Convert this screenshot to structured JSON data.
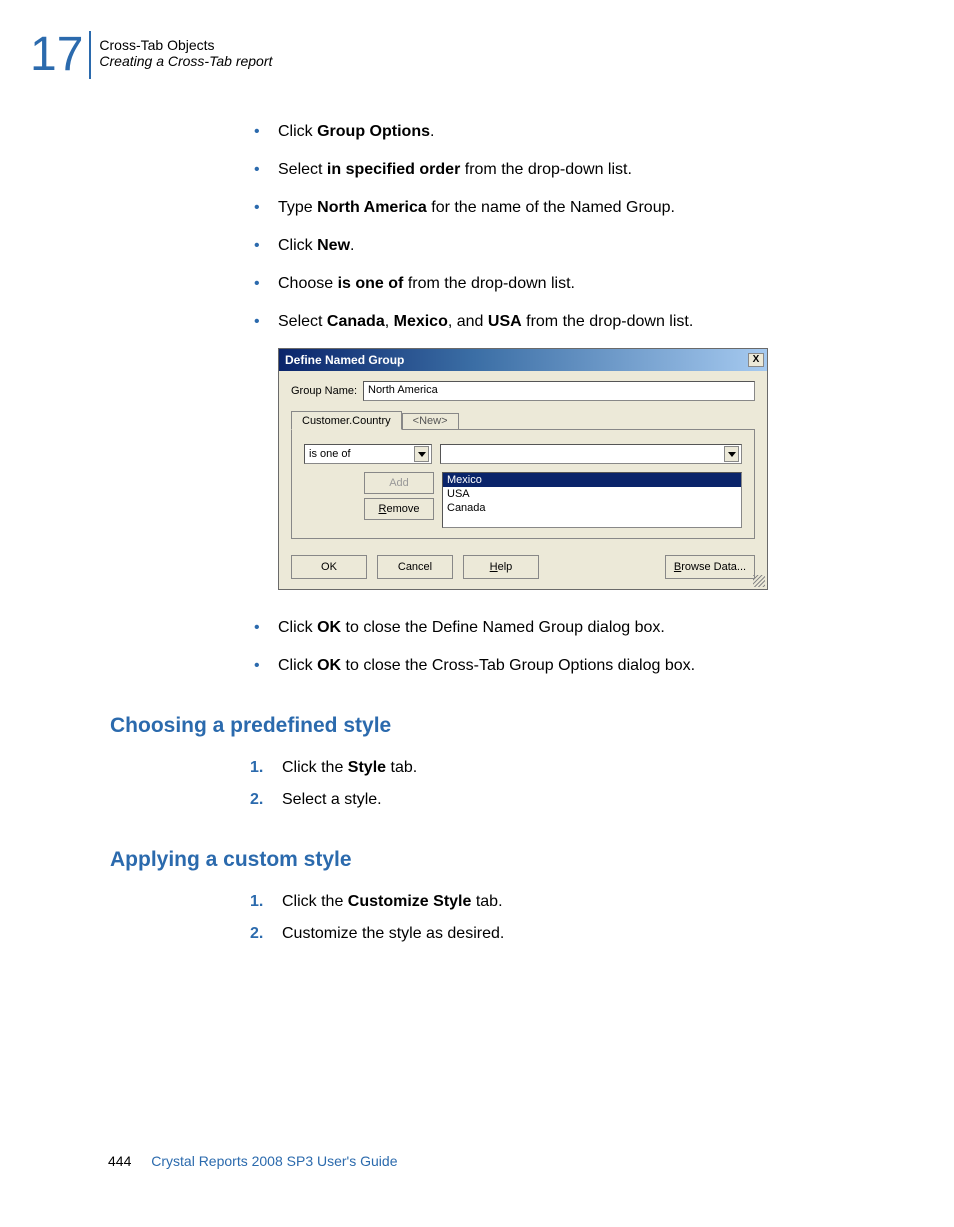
{
  "header": {
    "chapter": "17",
    "line1": "Cross-Tab Objects",
    "line2": "Creating a Cross-Tab report"
  },
  "bullets1": [
    {
      "pre": "Click ",
      "b": "Group Options",
      "post": "."
    },
    {
      "pre": "Select ",
      "b": "in specified order",
      "post": " from the drop-down list."
    },
    {
      "pre": "Type ",
      "b": "North America",
      "post": " for the name of the Named Group."
    },
    {
      "pre": "Click ",
      "b": "New",
      "post": "."
    },
    {
      "pre": "Choose ",
      "b": "is one of",
      "post": " from the drop-down list."
    },
    {
      "pre": "Select ",
      "b": "Canada",
      "post": ", ",
      "b2": "Mexico",
      "post2": ", and ",
      "b3": "USA",
      "post3": " from the drop-down list."
    }
  ],
  "dialog": {
    "title": "Define Named Group",
    "groupNameLabel": "Group Name:",
    "groupNameValue": "North America",
    "tab1": "Customer.Country",
    "tab2": "<New>",
    "operator": "is one of",
    "addLabel": "Add",
    "removeLabel": "Remove",
    "removePrefix": "R",
    "listItems": [
      "Mexico",
      "USA",
      "Canada"
    ],
    "ok": "OK",
    "cancel": "Cancel",
    "help": "Help",
    "helpPrefix": "H",
    "browse": "Browse Data...",
    "browsePrefix": "B"
  },
  "bullets2": [
    {
      "pre": "Click ",
      "b": "OK",
      "post": " to close the Define Named Group dialog box."
    },
    {
      "pre": "Click ",
      "b": "OK",
      "post": " to close the Cross-Tab Group Options dialog box."
    }
  ],
  "section1": {
    "title": "Choosing a predefined style",
    "steps": [
      {
        "pre": "Click the ",
        "b": "Style",
        "post": " tab."
      },
      {
        "pre": "Select a style.",
        "b": "",
        "post": ""
      }
    ]
  },
  "section2": {
    "title": "Applying a custom style",
    "steps": [
      {
        "pre": "Click the ",
        "b": "Customize Style",
        "post": " tab."
      },
      {
        "pre": "Customize the style as desired.",
        "b": "",
        "post": ""
      }
    ]
  },
  "footer": {
    "page": "444",
    "doc": "Crystal Reports 2008 SP3 User's Guide"
  }
}
